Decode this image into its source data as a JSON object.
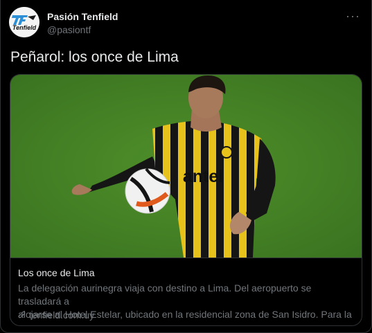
{
  "author": {
    "name": "Pasión Tenfield",
    "handle": "@pasiontf",
    "avatar_text": "Tenfield"
  },
  "more_glyph": "···",
  "tweet": {
    "text": "Peñarol: los once de Lima"
  },
  "card": {
    "image_text": "antel",
    "title": "Los once de Lima",
    "description_line1": "La delegación aurinegra viaja con destino a Lima. Del aeropuerto se trasladará a",
    "description_line2": "alojarse al Hotel Estelar, ubicado en la residencial zona de San Isidro. Para la ...",
    "domain": "tenfield.com.uy"
  },
  "colors": {
    "background": "#000000",
    "border": "#2f3336",
    "text_primary": "#e7e9ea",
    "text_secondary": "#71767b"
  }
}
